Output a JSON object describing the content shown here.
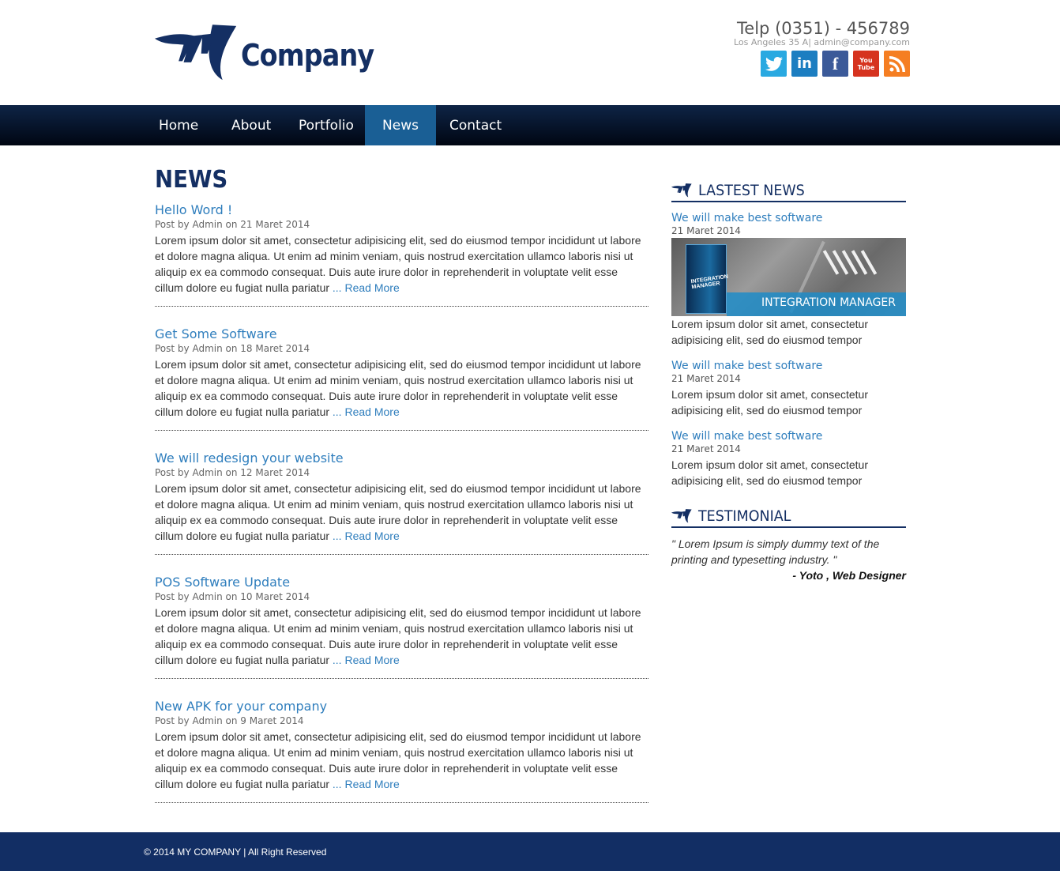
{
  "brand": {
    "name": "Company",
    "phone": "Telp (0351) - 456789",
    "address": "Los Angeles 35 A| admin@company.com"
  },
  "socials": [
    {
      "name": "twitter-icon",
      "glyph": "t"
    },
    {
      "name": "linkedin-icon",
      "glyph": "in"
    },
    {
      "name": "facebook-icon",
      "glyph": "f"
    },
    {
      "name": "youtube-icon",
      "glyph": "You Tube"
    },
    {
      "name": "rss-icon",
      "glyph": "rss"
    }
  ],
  "nav": {
    "items": [
      "Home",
      "About",
      "Portfolio",
      "News",
      "Contact"
    ],
    "active": "News"
  },
  "page": {
    "title": "NEWS",
    "read_more": "Read More",
    "ellipsis": "... "
  },
  "posts": [
    {
      "title": "Hello Word !",
      "meta": "Post by Admin on 21 Maret 2014",
      "body": "Lorem ipsum dolor sit amet, consectetur adipisicing elit, sed do eiusmod tempor incididunt ut labore et dolore magna aliqua. Ut enim ad minim veniam, quis nostrud exercitation ullamco laboris nisi ut aliquip ex ea commodo consequat. Duis aute irure dolor in reprehenderit in voluptate velit esse cillum dolore eu fugiat nulla pariatur "
    },
    {
      "title": "Get Some Software",
      "meta": "Post by Admin on 18 Maret 2014",
      "body": "Lorem ipsum dolor sit amet, consectetur adipisicing elit, sed do eiusmod tempor incididunt ut labore et dolore magna aliqua. Ut enim ad minim veniam, quis nostrud exercitation ullamco laboris nisi ut aliquip ex ea commodo consequat. Duis aute irure dolor in reprehenderit in voluptate velit esse cillum dolore eu fugiat nulla pariatur "
    },
    {
      "title": "We will redesign your website",
      "meta": "Post by Admin on 12 Maret 2014",
      "body": "Lorem ipsum dolor sit amet, consectetur adipisicing elit, sed do eiusmod tempor incididunt ut labore et dolore magna aliqua. Ut enim ad minim veniam, quis nostrud exercitation ullamco laboris nisi ut aliquip ex ea commodo consequat. Duis aute irure dolor in reprehenderit in voluptate velit esse cillum dolore eu fugiat nulla pariatur "
    },
    {
      "title": "POS Software Update",
      "meta": "Post by Admin on 10 Maret 2014",
      "body": "Lorem ipsum dolor sit amet, consectetur adipisicing elit, sed do eiusmod tempor incididunt ut labore et dolore magna aliqua. Ut enim ad minim veniam, quis nostrud exercitation ullamco laboris nisi ut aliquip ex ea commodo consequat. Duis aute irure dolor in reprehenderit in voluptate velit esse cillum dolore eu fugiat nulla pariatur "
    },
    {
      "title": "New APK for your company",
      "meta": "Post by Admin on 9 Maret 2014",
      "body": "Lorem ipsum dolor sit amet, consectetur adipisicing elit, sed do eiusmod tempor incididunt ut labore et dolore magna aliqua. Ut enim ad minim veniam, quis nostrud exercitation ullamco laboris nisi ut aliquip ex ea commodo consequat. Duis aute irure dolor in reprehenderit in voluptate velit esse cillum dolore eu fugiat nulla pariatur "
    }
  ],
  "sidebar": {
    "latest_title": "LASTEST NEWS",
    "banner_caption": "INTEGRATION MANAGER",
    "banner_box_text": "INTEGRATION MANAGER",
    "latest": [
      {
        "title": "We will make best software",
        "date": "21 Maret 2014",
        "text": "Lorem ipsum dolor sit amet, consectetur adipisicing elit, sed do eiusmod tempor"
      },
      {
        "title": "We will make best software",
        "date": "21 Maret 2014",
        "text": "Lorem ipsum dolor sit amet, consectetur adipisicing elit, sed do eiusmod tempor"
      },
      {
        "title": "We will make best software",
        "date": "21 Maret 2014",
        "text": "Lorem ipsum dolor sit amet, consectetur adipisicing elit, sed do eiusmod tempor"
      }
    ],
    "testimonial_title": "TESTIMONIAL",
    "testimonial_quote": "\" Lorem Ipsum is simply dummy text of the printing and typesetting industry. \"",
    "testimonial_author": "- Yoto , Web Designer"
  },
  "footer": {
    "text": "© 2014 MY COMPANY | All Right Reserved"
  },
  "colors": {
    "brand": "#142f63",
    "link": "#2f7ebd",
    "nav_active": "#1a5f95",
    "footer": "#122e64"
  }
}
